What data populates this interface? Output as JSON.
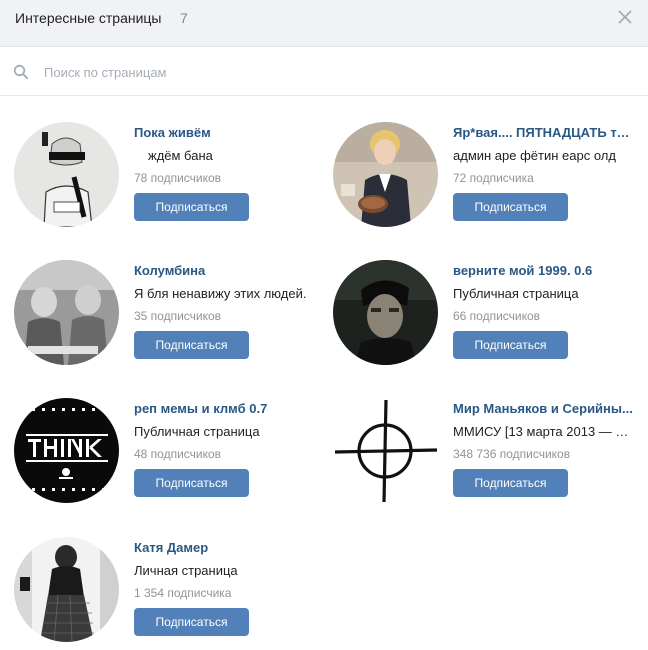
{
  "header": {
    "title": "Интересные страницы",
    "count": "7"
  },
  "search": {
    "placeholder": "Поиск по страницам"
  },
  "pages": [
    {
      "name": "Пока живём",
      "description": "ждём бана",
      "subscribers": "78 подписчиков",
      "button": "Подписаться",
      "avatar": "sketch-drawing-avatar"
    },
    {
      "name": "Яр*вая.... ПЯТНАДЦАТЬ то...",
      "description": "админ аре фётин еарс олд",
      "subscribers": "72 подписчика",
      "button": "Подписаться",
      "avatar": "woman-portrait-avatar"
    },
    {
      "name": "Колумбина",
      "description": "Я бля ненавижу этих людей.",
      "subscribers": "35 подписчиков",
      "button": "Подписаться",
      "avatar": "grayscale-photo-avatar"
    },
    {
      "name": "верните мой 1999. 0.6",
      "description": "Публичная страница",
      "subscribers": "66 подписчиков",
      "button": "Подписаться",
      "avatar": "dark-portrait-avatar"
    },
    {
      "name": "реп мемы и клмб 0.7",
      "description": "Публичная страница",
      "subscribers": "48 подписчиков",
      "button": "Подписаться",
      "avatar": "think-text-avatar"
    },
    {
      "name": "Мир Маньяков и Серийны...",
      "description": "ММИСУ [13 марта 2013 — 2...",
      "subscribers": "348 736 подписчиков",
      "button": "Подписаться",
      "avatar": "crosshair-symbol-avatar"
    },
    {
      "name": "Катя Дамер",
      "description": "Личная страница",
      "subscribers": "1 354 подписчика",
      "button": "Подписаться",
      "avatar": "person-photo-avatar"
    }
  ],
  "colors": {
    "link": "#2a5885",
    "button": "#5181b8",
    "header_bg": "#f0f2f5",
    "muted": "#939393"
  }
}
